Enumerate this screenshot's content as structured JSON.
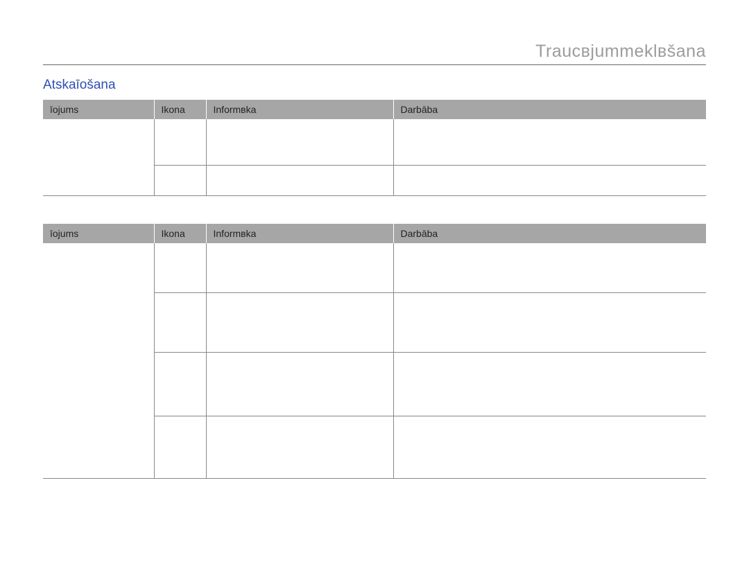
{
  "header": {
    "title": "Traucвjummeklвšana"
  },
  "section": {
    "title": "Atskaīošana"
  },
  "table1": {
    "headers": {
      "c1": "īojums",
      "c2": "Ikona",
      "c3": "Informвka",
      "c4": "Darbāba"
    }
  },
  "table2": {
    "headers": {
      "c1": "īojums",
      "c2": "Ikona",
      "c3": "Informвka",
      "c4": "Darbāba"
    }
  },
  "pageNumber": ""
}
